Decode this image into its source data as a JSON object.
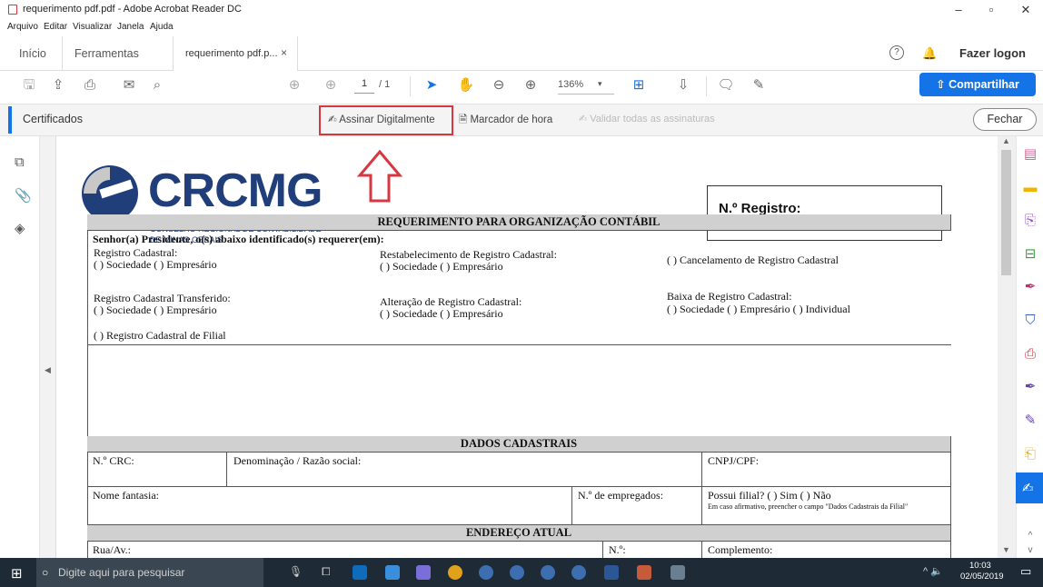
{
  "window": {
    "title": "requerimento pdf.pdf - Adobe Acrobat Reader DC",
    "minimize": "–",
    "maximize": "▫",
    "close": "✕"
  },
  "menu": [
    "Arquivo",
    "Editar",
    "Visualizar",
    "Janela",
    "Ajuda"
  ],
  "tabs": {
    "home": "Início",
    "tools": "Ferramentas",
    "document": "requerimento pdf.p...",
    "document_close": "×",
    "login": "Fazer logon"
  },
  "toolbar": {
    "page_current": "1",
    "page_total": "/ 1",
    "zoom": "136%",
    "share": "Compartilhar"
  },
  "certbar": {
    "title": "Certificados",
    "sign": "Assinar Digitalmente",
    "timestamp": "Marcador de hora",
    "validate": "Validar todas as assinaturas",
    "close": "Fechar"
  },
  "document": {
    "logo_text": "CRCMG",
    "logo_line1": "CONSELHO REGIONAL DE CONTABILIDADE",
    "logo_line2": "DE MINAS GERAIS",
    "registro": "N.º Registro:",
    "main_title": "REQUERIMENTO PARA ORGANIZAÇÃO CONTÁBIL",
    "intro": "Senhor(a) Presidente, o(s) abaixo identificado(s) requerer(em):",
    "opt1_title": "Registro Cadastral:",
    "opt1_choices": "( ) Sociedade  ( ) Empresário",
    "opt2_title": "Restabelecimento de Registro Cadastral:",
    "opt2_choices": "( ) Sociedade  ( ) Empresário",
    "opt3": "( ) Cancelamento de Registro Cadastral",
    "opt4_title": "Registro Cadastral Transferido:",
    "opt4_choices": "( ) Sociedade  ( ) Empresário",
    "opt5_title": "Alteração de Registro Cadastral:",
    "opt5_choices": "( ) Sociedade  ( ) Empresário",
    "opt6_title": "Baixa de Registro Cadastral:",
    "opt6_choices": "( ) Sociedade   ( ) Empresário   ( ) Individual",
    "opt7": "( ) Registro Cadastral de Filial",
    "section_dados": "DADOS CADASTRAIS",
    "crc": "N.º CRC:",
    "denominacao": "Denominação / Razão social:",
    "cnpj": "CNPJ/CPF:",
    "fantasia": "Nome fantasia:",
    "empregados": "N.º de empregados:",
    "filial": "Possui filial?    (    ) Sim      (    ) Não",
    "filial_note": "Em caso afirmativo, preencher o campo \"Dados Cadastrais da Filial\"",
    "section_endereco": "ENDEREÇO ATUAL",
    "rua": "Rua/Av.:",
    "numero": "N.º:",
    "complemento": "Complemento:"
  },
  "taskbar": {
    "search_placeholder": "Digite aqui para pesquisar",
    "time": "10:03",
    "date": "02/05/2019"
  },
  "colors": {
    "accent_blue": "#1473e6",
    "highlight_red": "#d7373f",
    "logo_blue": "#1f3e7a",
    "taskbar": "#1e2a36"
  }
}
